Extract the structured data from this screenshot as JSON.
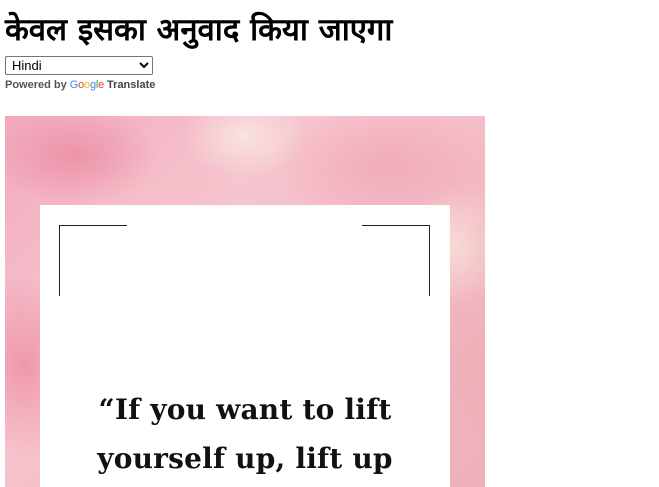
{
  "header": {
    "title": "केवल इसका अनुवाद किया जाएगा"
  },
  "translate_widget": {
    "selected_language": "Hindi",
    "powered_by_label": "Powered by",
    "google_letters": [
      {
        "char": "G",
        "color": "#4285F4"
      },
      {
        "char": "o",
        "color": "#EA4335"
      },
      {
        "char": "o",
        "color": "#FBBC05"
      },
      {
        "char": "g",
        "color": "#4285F4"
      },
      {
        "char": "l",
        "color": "#34A853"
      },
      {
        "char": "e",
        "color": "#EA4335"
      }
    ],
    "translate_label": "Translate"
  },
  "hero": {
    "quote_line_1": "“If you want to lift",
    "quote_line_2": "yourself up, lift up"
  }
}
